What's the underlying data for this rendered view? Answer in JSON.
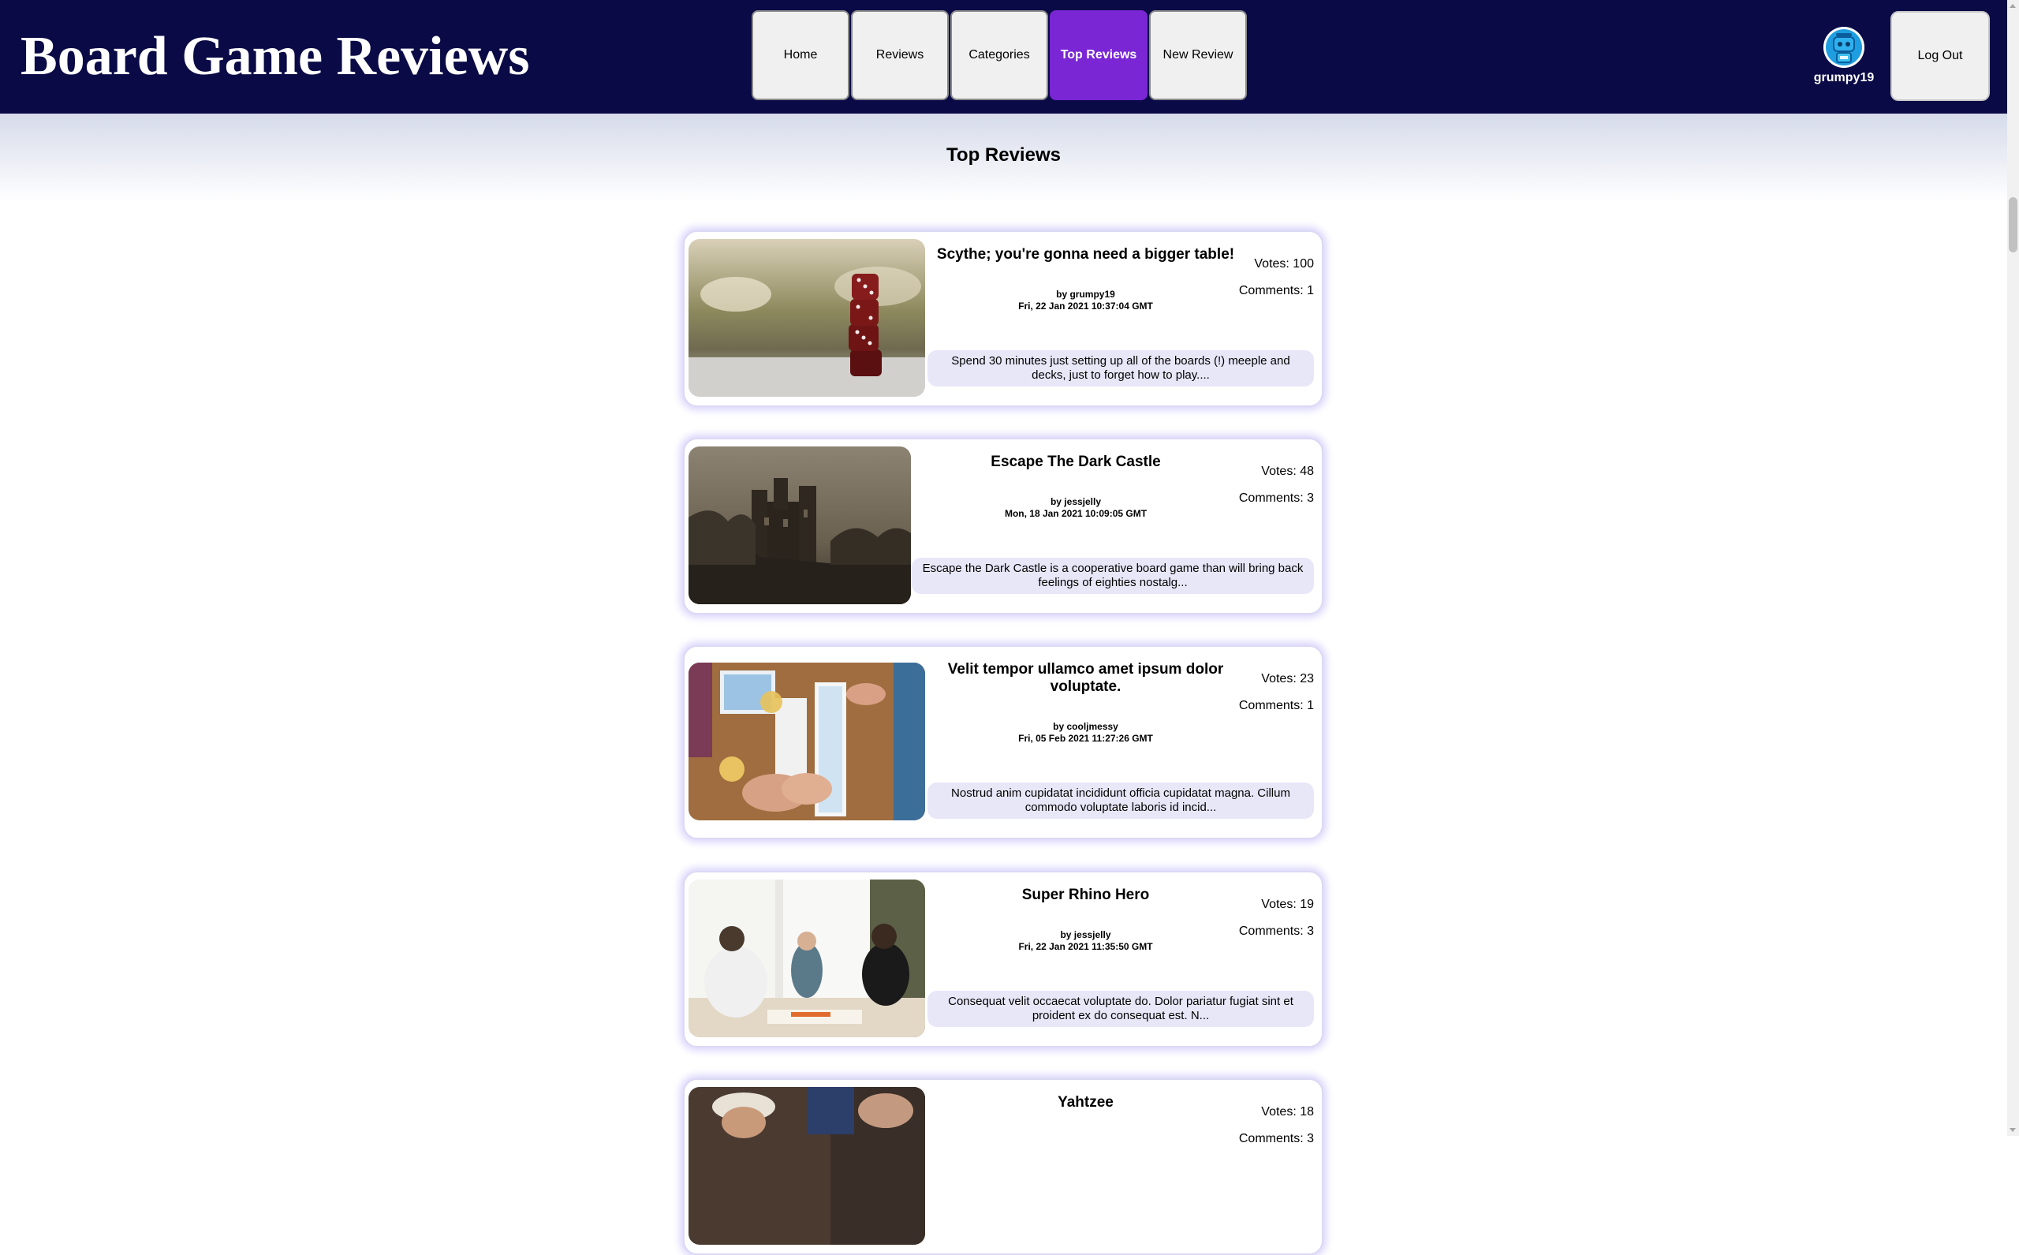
{
  "header": {
    "site_title": "Board Game Reviews",
    "nav": [
      {
        "label": "Home"
      },
      {
        "label": "Reviews"
      },
      {
        "label": "Categories"
      },
      {
        "label": "Top Reviews",
        "active": true
      },
      {
        "label": "New Review"
      }
    ],
    "user": {
      "username": "grumpy19",
      "avatar_icon": "robot-avatar-icon"
    },
    "logout_label": "Log Out"
  },
  "page": {
    "title": "Top Reviews"
  },
  "reviews": [
    {
      "title": "Scythe; you're gonna need a bigger table!",
      "author": "by grumpy19",
      "date": "Fri, 22 Jan 2021 10:37:04 GMT",
      "votes": "Votes: 100",
      "comments": "Comments: 1",
      "excerpt": "Spend 30 minutes just setting up all of the boards (!) meeple and decks, just to forget how to play....",
      "image": "stacked-dice-photo"
    },
    {
      "title": "Escape The Dark Castle",
      "author": "by jessjelly",
      "date": "Mon, 18 Jan 2021 10:09:05 GMT",
      "votes": "Votes: 48",
      "comments": "Comments: 3",
      "excerpt": "Escape the Dark Castle is a cooperative board game than will bring back feelings of eighties nostalg...",
      "image": "dark-castle-photo"
    },
    {
      "title": "Velit tempor ullamco amet ipsum dolor voluptate.",
      "author": "by cooljmessy",
      "date": "Fri, 05 Feb 2021 11:27:26 GMT",
      "votes": "Votes: 23",
      "comments": "Comments: 1",
      "excerpt": "Nostrud anim cupidatat incididunt officia cupidatat magna. Cillum commodo voluptate laboris id incid...",
      "image": "tabletop-game-photo"
    },
    {
      "title": "Super Rhino Hero",
      "author": "by jessjelly",
      "date": "Fri, 22 Jan 2021 11:35:50 GMT",
      "votes": "Votes: 19",
      "comments": "Comments: 3",
      "excerpt": "Consequat velit occaecat voluptate do. Dolor pariatur fugiat sint et proident ex do consequat est. N...",
      "image": "family-playing-photo"
    },
    {
      "title": "Yahtzee",
      "votes": "Votes: 18",
      "comments": "Comments: 3",
      "image": "people-playing-photo"
    }
  ]
}
